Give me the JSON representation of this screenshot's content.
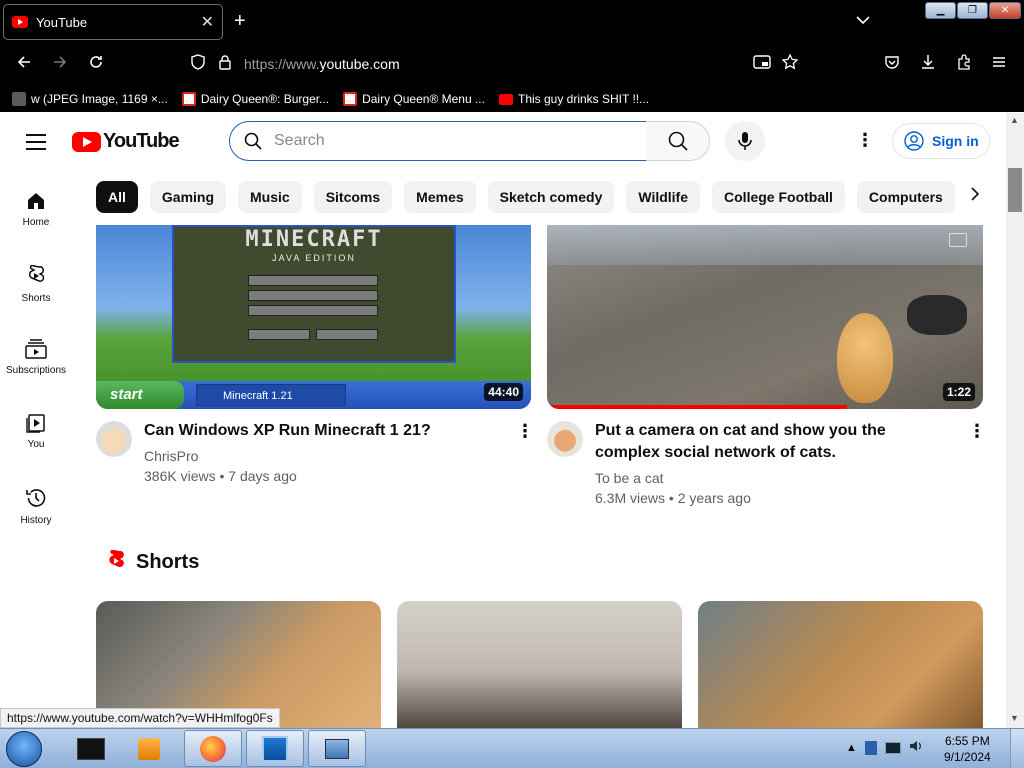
{
  "browser": {
    "tab_title": "YouTube",
    "url_prefix": "https://www.",
    "url_domain": "youtube.com",
    "bookmarks": [
      {
        "label": "w (JPEG Image, 1169 ×...",
        "color": "#5a5a5a"
      },
      {
        "label": "Dairy Queen®: Burger...",
        "color": "#e2231a"
      },
      {
        "label": "Dairy Queen® Menu ...",
        "color": "#e2231a"
      },
      {
        "label": "This guy drinks SHIT !!...",
        "color": "#ff0000"
      }
    ]
  },
  "header": {
    "logo": "YouTube",
    "search_placeholder": "Search",
    "signin": "Sign in"
  },
  "sidebar": {
    "items": [
      {
        "label": "Home"
      },
      {
        "label": "Shorts"
      },
      {
        "label": "Subscriptions"
      },
      {
        "label": "You"
      },
      {
        "label": "History"
      }
    ]
  },
  "chips": [
    "All",
    "Gaming",
    "Music",
    "Sitcoms",
    "Memes",
    "Sketch comedy",
    "Wildlife",
    "College Football",
    "Computers"
  ],
  "videos": [
    {
      "title": "Can Windows XP Run Minecraft 1 21?",
      "channel": "ChrisPro",
      "meta": "386K views • 7 days ago",
      "duration": "44:40",
      "thumb_text": "MINECRAFT",
      "thumb_sub": "JAVA EDITION",
      "taskbar_start": "start",
      "taskbar_item": "Minecraft 1.21"
    },
    {
      "title": "Put a camera on cat and show you the complex social network of cats.",
      "channel": "To be a cat",
      "meta": "6.3M views • 2 years ago",
      "duration": "1:22"
    }
  ],
  "shorts": {
    "heading": "Shorts"
  },
  "status_url": "https://www.youtube.com/watch?v=WHHmlfog0Fs",
  "taskbar": {
    "time": "6:55 PM",
    "date": "9/1/2024"
  }
}
